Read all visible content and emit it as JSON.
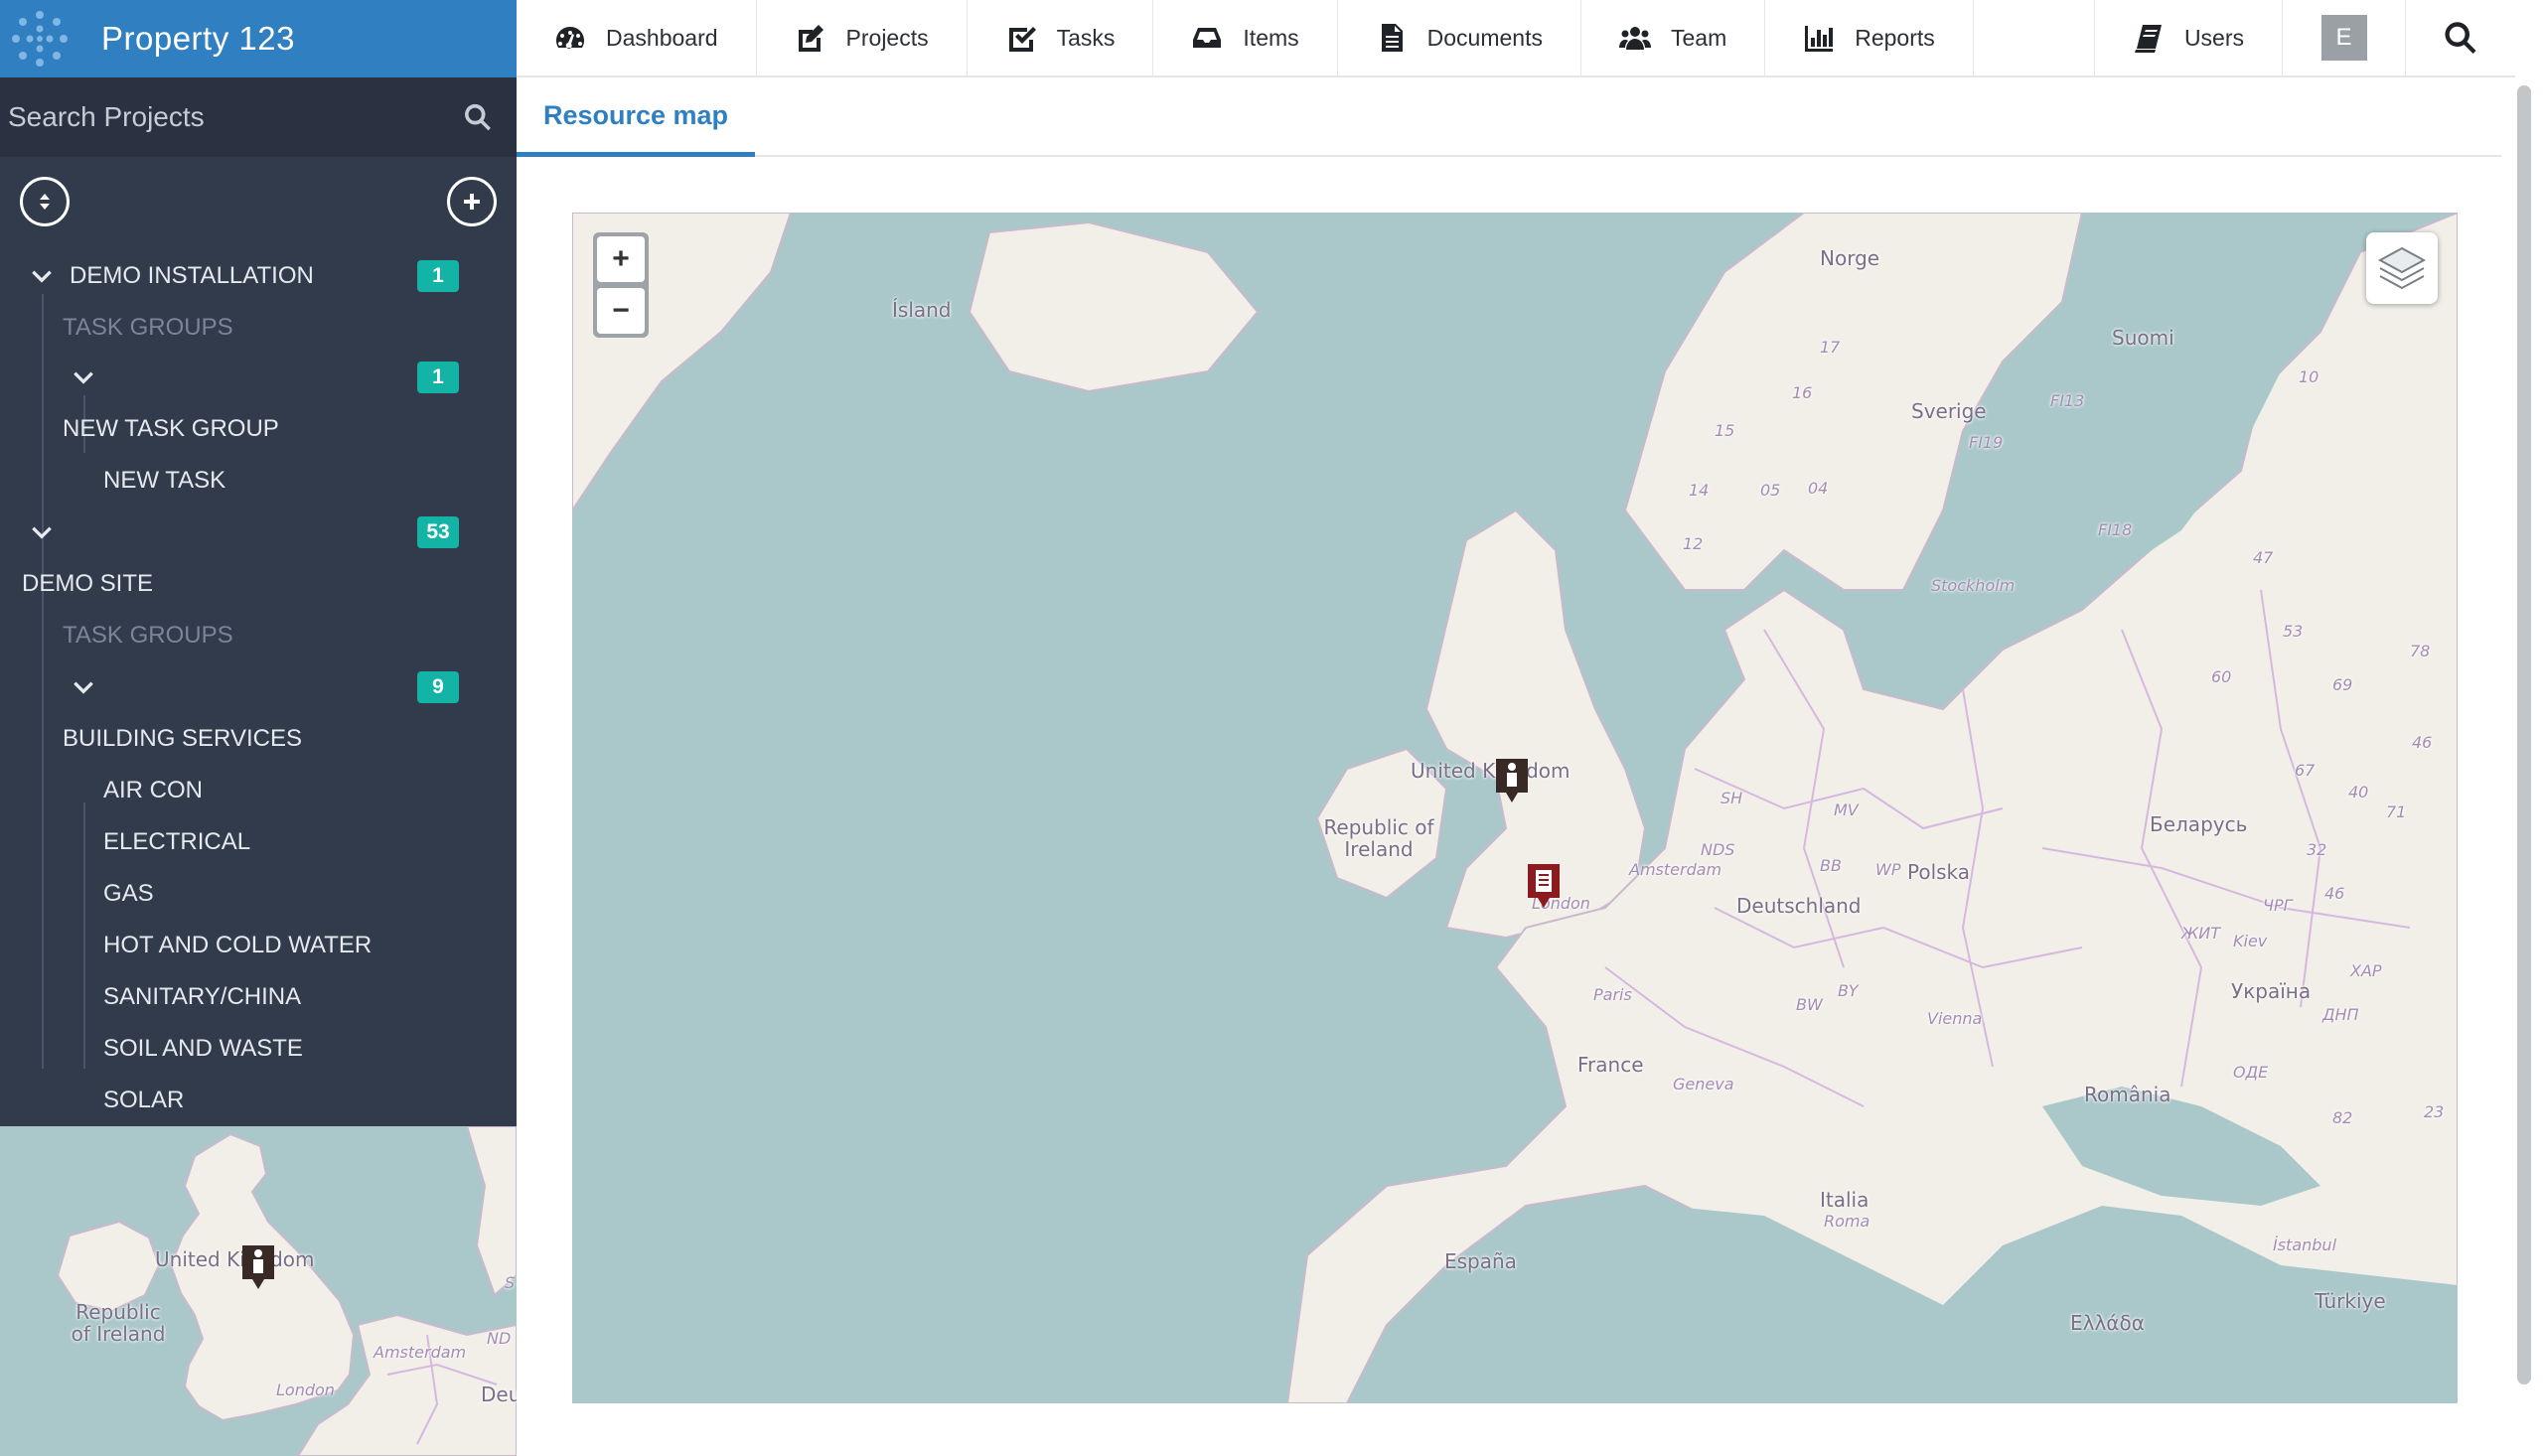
{
  "app": {
    "title": "Property 123"
  },
  "nav": {
    "items": [
      {
        "label": "Dashboard",
        "icon": "dashboard-icon"
      },
      {
        "label": "Projects",
        "icon": "edit-icon"
      },
      {
        "label": "Tasks",
        "icon": "checkbox-icon"
      },
      {
        "label": "Items",
        "icon": "inbox-icon"
      },
      {
        "label": "Documents",
        "icon": "document-icon"
      },
      {
        "label": "Team",
        "icon": "users-icon"
      },
      {
        "label": "Reports",
        "icon": "bar-chart-icon"
      }
    ],
    "users_label": "Users",
    "avatar_initial": "E"
  },
  "sidebar": {
    "search_placeholder": "Search Projects",
    "tree": {
      "project1": "DEMO INSTALLATION",
      "project1_badge": "1",
      "task_groups_1": "TASK GROUPS",
      "group1_badge": "1",
      "group1_name": "NEW TASK GROUP",
      "task1": "NEW TASK",
      "project2_badge": "53",
      "project2": "DEMO SITE",
      "task_groups_2": "TASK GROUPS",
      "group2_badge": "9",
      "group2_name": "BUILDING SERVICES",
      "tasks2": [
        "AIR CON",
        "ELECTRICAL",
        "GAS",
        "HOT AND COLD WATER",
        "SANITARY/CHINA",
        "SOIL AND WASTE",
        "SOLAR"
      ]
    }
  },
  "minimap": {
    "labels": [
      "United Kingdom",
      "Republic of Ireland",
      "Amsterdam",
      "London",
      "ND",
      "Deu",
      "S"
    ]
  },
  "main": {
    "tab_label": "Resource map"
  },
  "map": {
    "zoom_in": "+",
    "zoom_out": "−",
    "labels": {
      "countries": [
        "Ísland",
        "Norge",
        "Sverige",
        "Suomi",
        "United Kingdom",
        "Republic of Ireland",
        "Deutschland",
        "Polska",
        "France",
        "España",
        "Italia",
        "Беларусь",
        "Україна",
        "România",
        "Türkiye",
        "Ελλάδα"
      ],
      "cities": [
        "Stockholm",
        "Amsterdam",
        "London",
        "Paris",
        "Geneva",
        "Vienna",
        "Kiev",
        "Roma",
        "İstanbul"
      ],
      "regions": [
        "17",
        "16",
        "15",
        "14",
        "05",
        "04",
        "12",
        "FI13",
        "FI19",
        "FI18",
        "10",
        "47",
        "53",
        "60",
        "69",
        "78",
        "46",
        "67",
        "40",
        "71",
        "32",
        "46",
        "ЧРГ",
        "ХАР",
        "ДНП",
        "ОДЕ",
        "82",
        "23",
        "ЖИТ",
        "SH",
        "MV",
        "NDS",
        "BB",
        "WP",
        "BW",
        "BY"
      ]
    }
  },
  "colors": {
    "brand": "#2f7fc1",
    "sidebar": "#323b4c",
    "badge": "#13b4a6",
    "sea": "#aac8c9",
    "land": "#f2efe9"
  }
}
